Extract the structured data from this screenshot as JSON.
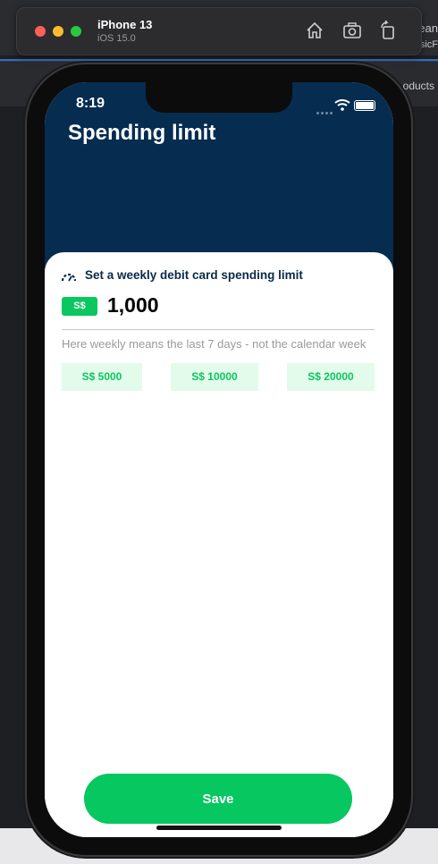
{
  "background": {
    "visible_text": [
      "ean",
      "sicF",
      "oducts"
    ]
  },
  "simulator": {
    "device_name": "iPhone 13",
    "os_version": "iOS 15.0",
    "toolbar_icons": [
      "home-icon",
      "screenshot-icon",
      "rotate-icon"
    ]
  },
  "status_bar": {
    "time": "8:19"
  },
  "header": {
    "title": "Spending limit"
  },
  "form": {
    "limit_label": "Set a weekly debit card spending limit",
    "currency": "S$",
    "amount": "1,000",
    "hint": "Here weekly means the last 7 days - not the calendar week",
    "presets": [
      "S$ 5000",
      "S$ 10000",
      "S$ 20000"
    ]
  },
  "actions": {
    "save_label": "Save"
  },
  "colors": {
    "header_bg": "#062c50",
    "accent_green": "#06c760",
    "preset_bg": "#e3fbea"
  }
}
